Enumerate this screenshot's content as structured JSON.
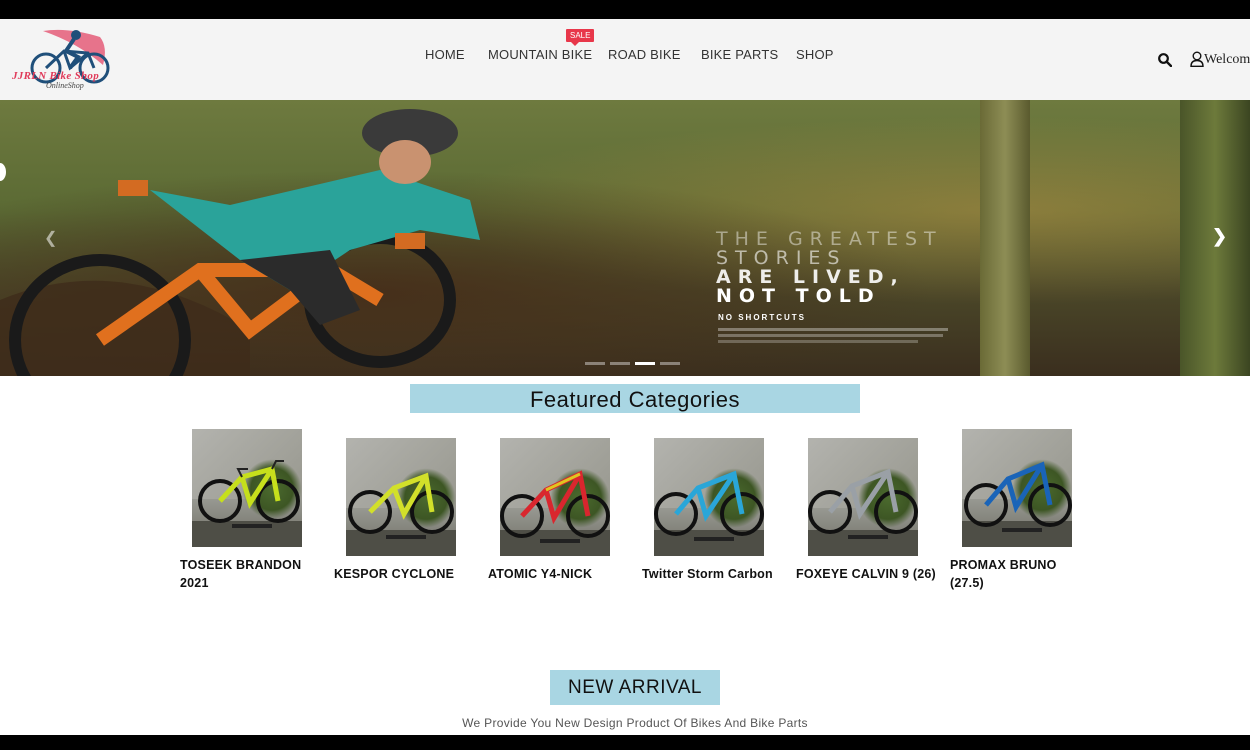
{
  "brand": {
    "name": "JJRLN Bike Shop",
    "tagline": "OnlineShop"
  },
  "nav": {
    "items": [
      {
        "label": "HOME"
      },
      {
        "label": "MOUNTAIN BIKE"
      },
      {
        "label": "ROAD BIKE"
      },
      {
        "label": "BIKE PARTS"
      },
      {
        "label": "SHOP"
      }
    ],
    "sale_badge": "SALE"
  },
  "header": {
    "welcome": "Welcome",
    "icons": [
      "search-icon",
      "user-icon"
    ]
  },
  "hero": {
    "line1": "THE GREATEST",
    "line2": "STORIES",
    "line3": "ARE LIVED,",
    "line4": "NOT TOLD",
    "small": "NO SHORTCUTS",
    "slide_count": 4,
    "active_slide": 3
  },
  "featured": {
    "title": "Featured Categories",
    "products": [
      {
        "name_line1": "TOSEEK BRANDON",
        "name_line2": "2021",
        "frame_color": "#c6df1c"
      },
      {
        "name_line1": "KESPOR CYCLONE",
        "name_line2": "",
        "frame_color": "#d2e02a"
      },
      {
        "name_line1": "ATOMIC Y4-NICK",
        "name_line2": "",
        "frame_color": "#e0c420"
      },
      {
        "name_line1": "Twitter Storm Carbon",
        "name_line2": "",
        "frame_color": "#2aa6d8"
      },
      {
        "name_line1": "FOXEYE CALVIN 9 (26)",
        "name_line2": "",
        "frame_color": "#9aa0a6"
      },
      {
        "name_line1": "PROMAX BRUNO",
        "name_line2": "(27.5)",
        "frame_color": "#1a64b8"
      }
    ]
  },
  "new_arrival": {
    "title": "NEW ARRIVAL",
    "subtitle": "We Provide You New Design Product Of Bikes And Bike Parts"
  },
  "colors": {
    "section_bg": "#a9d6e3",
    "sale": "#e8374a",
    "header_bg": "#f4f4f4"
  }
}
